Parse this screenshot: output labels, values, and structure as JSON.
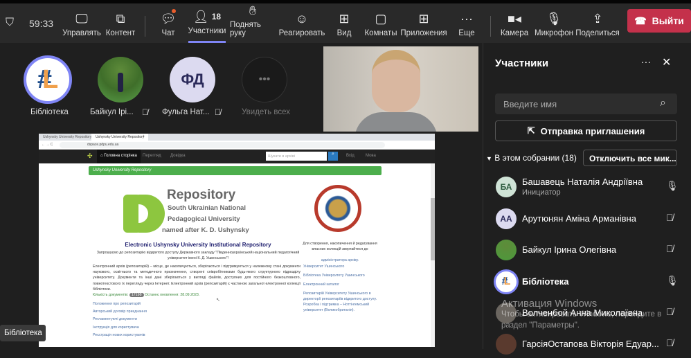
{
  "toolbar": {
    "timer": "59:33",
    "manage": "Управлять",
    "content": "Контент",
    "chat": "Чат",
    "participants": "Участники",
    "participants_count": "18",
    "raise_hand": "Поднять руку",
    "react": "Реагировать",
    "view": "Вид",
    "rooms": "Комнаты",
    "apps": "Приложения",
    "more": "Еще",
    "camera": "Камера",
    "mic": "Микрофон",
    "share": "Поделиться",
    "leave": "Выйти",
    "accent": "#7f85f5",
    "leave_color": "#c4314b"
  },
  "stage": {
    "tiles": [
      {
        "name": "Бібліотека"
      },
      {
        "name": "Байкул Ірі..."
      },
      {
        "name": "Фульга Нат...",
        "initials": "ФД"
      },
      {
        "name": "Увидеть всех"
      }
    ],
    "presenter_label": "Бібліотека",
    "logo_text": "Ushynsky University"
  },
  "shared": {
    "tabs": [
      "Ushynsky University Repository",
      "Ushynsky University Repository"
    ],
    "url": "dspace.pdpu.edu.ua",
    "nav": {
      "home": "Головна сторінка",
      "browse": "Перегляд",
      "help": "Довідка",
      "search_placeholder": "Шукати в архіві",
      "login": "Вхід",
      "lang": "Мова"
    },
    "banner": "Ushynsky University Repository",
    "logo": {
      "title": "Repository",
      "l1": "South Ukrainian National",
      "l2": "Pedagogical University",
      "l3": "named after K. D. Ushynsky"
    },
    "heading": "Electronic Ushynsky University Institutional Repository",
    "welcome": "Запрошуємо до репозитарію відкритого доступу Державного закладу \"Південноукраїнський національний педагогічний університет імені К. Д. Ушинського\"!",
    "body": "Електронний архів (репозитарій) – місце, де накопичуються, зберігаються і підтримуються у належному стані документи наукового, освітнього та методичного призначення, створені співробітниками будь-якого структурного підрозділу університету. Документи та інші дані зберігаються у вигляді файлів, доступних для постійного безкоштовного, повнотекстового їх перегляду через Інтернет. Електронний архів (репозитарій) є частиною загальної електронної колекції бібліотеки.",
    "count_label": "Кількість документів:",
    "count": "17198",
    "updated": "Останнє оновлення: 28.09.2023.",
    "links": [
      "Положення про репозитарій",
      "Авторський договір приєднання",
      "Регламентуючі документи",
      "Інструкція для користувача",
      "Реєстрація нових користувачів"
    ],
    "side_text": "Для створення, накопичення й редагування власних колекцій звертайтеся до",
    "side_admin": "адміністратора архіву.",
    "side_links": [
      "Університет Ушинського",
      "Бібліотека Університету Ушинського",
      "Електронний каталог",
      "Репозитарій Університету Ушинського в директорії репозитаріїв відкритого доступу. Розробка і підтримка – Ноттінгемський університет (Великобританія)."
    ]
  },
  "panel": {
    "title": "Участники",
    "search_placeholder": "Введите имя",
    "invite": "Отправка приглашения",
    "section": "В этом собрании (18)",
    "mute_all": "Отключить все мик...",
    "people": [
      {
        "initials": "БА",
        "name": "Башавець Наталія Андріївна",
        "role": "Инициатор",
        "muted": false
      },
      {
        "initials": "АА",
        "name": "Арутюнян Аміна Арманівна",
        "muted": true
      },
      {
        "name": "Байкул Ірина Олегівна",
        "muted": true
      },
      {
        "name": "Бібліотека",
        "muted": false
      },
      {
        "name": "Волченбой Анна Миколаївна",
        "muted": true
      },
      {
        "name": "ГарсіяОстапова Вікторія Едуар...",
        "muted": true
      }
    ]
  },
  "watermark": {
    "title": "Активация Windows",
    "text": "Чтобы активировать Windows, перейдите в раздел \"Параметры\"."
  }
}
